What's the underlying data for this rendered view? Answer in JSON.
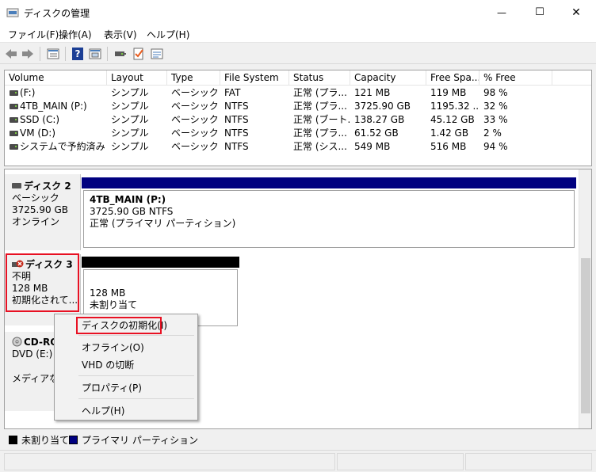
{
  "window": {
    "title": "ディスクの管理",
    "minimize_glyph": "—",
    "maximize_glyph": "☐",
    "close_glyph": "✕"
  },
  "menu": [
    "ファイル(F)",
    "操作(A)",
    "表示(V)",
    "ヘルプ(H)"
  ],
  "toolbar": {
    "buttons": [
      "back-arrow-icon",
      "forward-arrow-icon",
      "list-view-icon",
      "help-icon",
      "properties-icon",
      "connect-icon",
      "check-icon",
      "settings-list-icon"
    ],
    "help_glyph": "?"
  },
  "volume_table": {
    "columns": [
      "Volume",
      "Layout",
      "Type",
      "File System",
      "Status",
      "Capacity",
      "Free Spa...",
      "% Free"
    ],
    "rows": [
      [
        "(F:)",
        "シンプル",
        "ベーシック",
        "FAT",
        "正常 (プラ...",
        "121 MB",
        "119 MB",
        "98 %"
      ],
      [
        "4TB_MAIN (P:)",
        "シンプル",
        "ベーシック",
        "NTFS",
        "正常 (プラ...",
        "3725.90 GB",
        "1195.32 ...",
        "32 %"
      ],
      [
        "SSD (C:)",
        "シンプル",
        "ベーシック",
        "NTFS",
        "正常 (ブート...",
        "138.27 GB",
        "45.12 GB",
        "33 %"
      ],
      [
        "VM (D:)",
        "シンプル",
        "ベーシック",
        "NTFS",
        "正常 (プラ...",
        "61.52 GB",
        "1.42 GB",
        "2 %"
      ],
      [
        "システムで予約済み",
        "シンプル",
        "ベーシック",
        "NTFS",
        "正常 (シス...",
        "549 MB",
        "516 MB",
        "94 %"
      ]
    ]
  },
  "disks": {
    "disk2": {
      "name": "ディスク 2",
      "type": "ベーシック",
      "size": "3725.90 GB",
      "state": "オンライン",
      "partition": {
        "label": "4TB_MAIN  (P:)",
        "detail": "3725.90 GB NTFS",
        "status": "正常 (プライマリ パーティション)",
        "bar_color": "#000080"
      }
    },
    "disk3": {
      "name": "ディスク 3",
      "type": "不明",
      "size": "128 MB",
      "state": "初期化されて...",
      "partition": {
        "size": "128 MB",
        "status": "未割り当て",
        "bar_color": "#000000"
      }
    },
    "cdrom": {
      "name": "CD-RO",
      "drive": "DVD (E:)",
      "media": "メディアなし"
    }
  },
  "context_menu": {
    "items": [
      "ディスクの初期化(I)",
      "オフライン(O)",
      "VHD の切断",
      "プロパティ(P)",
      "ヘルプ(H)"
    ]
  },
  "legend": {
    "unallocated": "未割り当て",
    "primary": "プライマリ パーティション",
    "unallocated_color": "#000000",
    "primary_color": "#000080"
  },
  "highlight_color": "#e81123"
}
